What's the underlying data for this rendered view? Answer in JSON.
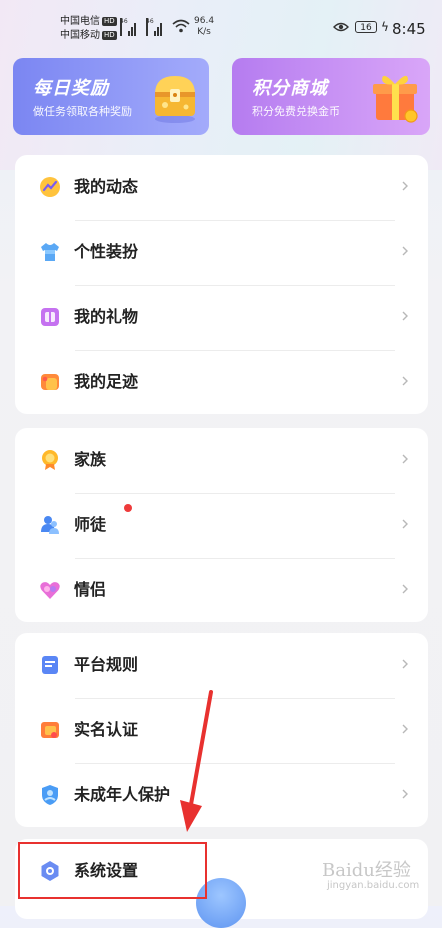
{
  "status_bar": {
    "carrier1": "中国电信",
    "carrier2": "中国移动",
    "hd_badge": "HD",
    "net1": "46",
    "net2": "46",
    "speed_value": "96.4",
    "speed_unit": "K/s",
    "battery": "16",
    "time": "8:45"
  },
  "promos": [
    {
      "title": "每日奖励",
      "subtitle": "做任务领取各种奖励",
      "icon": "treasure-chest-icon"
    },
    {
      "title": "积分商城",
      "subtitle": "积分免费兑换金币",
      "icon": "gift-box-icon"
    }
  ],
  "groups": [
    {
      "items": [
        {
          "label": "我的动态",
          "icon": "feed-icon"
        },
        {
          "label": "个性装扮",
          "icon": "shirt-icon"
        },
        {
          "label": "我的礼物",
          "icon": "gift-icon"
        },
        {
          "label": "我的足迹",
          "icon": "footprint-icon"
        }
      ]
    },
    {
      "items": [
        {
          "label": "家族",
          "icon": "family-medal-icon"
        },
        {
          "label": "师徒",
          "icon": "mentor-icon",
          "badge": "red-dot"
        },
        {
          "label": "情侣",
          "icon": "heart-icon"
        }
      ]
    },
    {
      "items": [
        {
          "label": "平台规则",
          "icon": "rules-icon"
        },
        {
          "label": "实名认证",
          "icon": "verify-icon"
        },
        {
          "label": "未成年人保护",
          "icon": "minor-protection-icon"
        }
      ]
    },
    {
      "items": [
        {
          "label": "系统设置",
          "icon": "settings-icon"
        }
      ]
    }
  ],
  "watermark": {
    "text": "Baidu经验",
    "url": "jingyan.baidu.com"
  },
  "colors": {
    "highlight": "#e8312f",
    "promo_left": "#7b86f2",
    "promo_right": "#c78cf5"
  }
}
